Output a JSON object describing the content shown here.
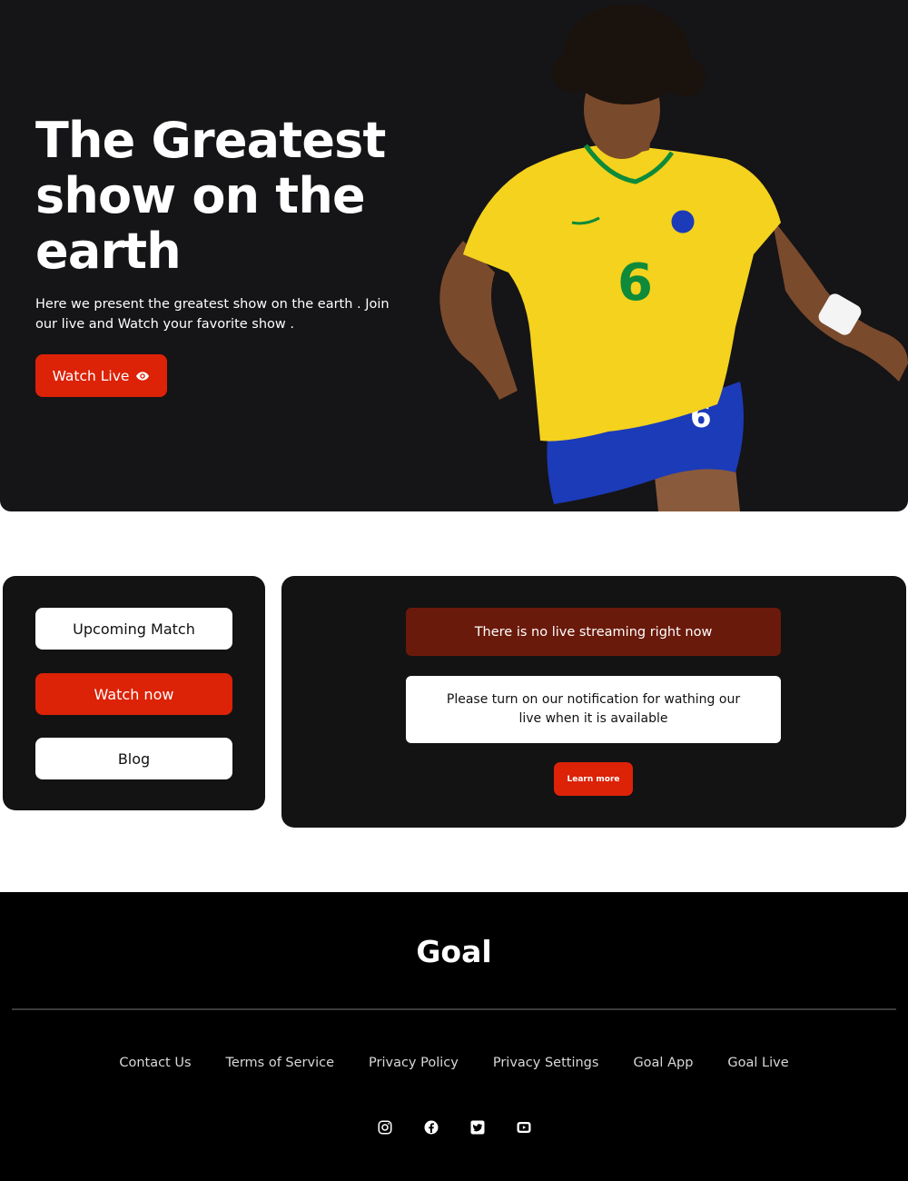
{
  "hero": {
    "title": "The Greatest show on the earth",
    "description": "Here we present the greatest show on the earth . Join our live and Watch your favorite show .",
    "watch_live_label": "Watch Live",
    "jersey_number": "6"
  },
  "side_menu": {
    "upcoming_label": "Upcoming Match",
    "watch_now_label": "Watch now",
    "blog_label": "Blog"
  },
  "live_panel": {
    "no_live_text": "There is no live streaming right now",
    "notify_text": "Please turn on our notification for wathing our live when it is available",
    "learn_more_label": "Learn more"
  },
  "footer": {
    "logo": "Goal",
    "links": [
      "Contact Us",
      "Terms of Service",
      "Privacy Policy",
      "Privacy Settings",
      "Goal App",
      "Goal Live"
    ],
    "social": [
      "instagram-icon",
      "facebook-icon",
      "twitter-icon",
      "youtube-icon"
    ]
  },
  "colors": {
    "accent": "#dc2207",
    "dark": "#131313",
    "alert": "#6a1a0b"
  }
}
